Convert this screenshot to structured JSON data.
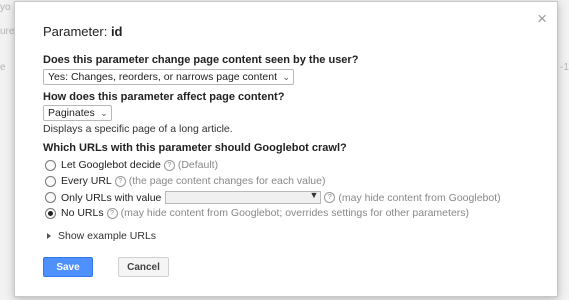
{
  "background": {
    "fragments": [
      "yo",
      "ure",
      "e",
      "-1"
    ]
  },
  "dialog": {
    "close_glyph": "×",
    "title_prefix": "Parameter:",
    "param_name": "id",
    "q1": {
      "question": "Does this parameter change page content seen by the user?",
      "selected": "Yes: Changes, reorders, or narrows page content"
    },
    "q2": {
      "question": "How does this parameter affect page content?",
      "selected": "Paginates",
      "description": "Displays a specific page of a long article."
    },
    "q3": {
      "question": "Which URLs with this parameter should Googlebot crawl?",
      "options": [
        {
          "label": "Let Googlebot decide",
          "note": "(Default)",
          "checked": false
        },
        {
          "label": "Every URL",
          "note": "(the page content changes for each value)",
          "checked": false
        },
        {
          "label": "Only URLs with value",
          "value": "",
          "note": "(may hide content from Googlebot)",
          "checked": false
        },
        {
          "label": "No URLs",
          "note": "(may hide content from Googlebot; overrides settings for other parameters)",
          "checked": true
        }
      ]
    },
    "show_examples": "Show example URLs",
    "buttons": {
      "save": "Save",
      "cancel": "Cancel"
    }
  },
  "colors": {
    "primary_button": "#4d90fe",
    "dialog_bg": "#ffffff"
  }
}
